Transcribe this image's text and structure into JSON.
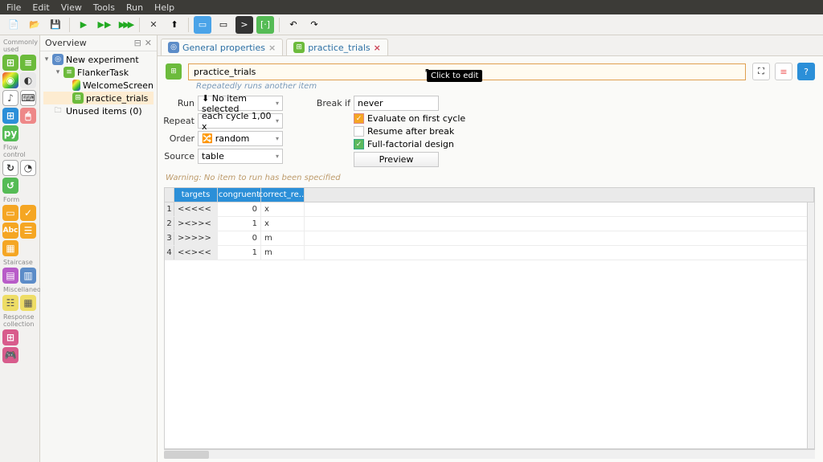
{
  "menu": [
    "File",
    "Edit",
    "View",
    "Tools",
    "Run",
    "Help"
  ],
  "overview": {
    "title": "Overview",
    "items": {
      "root": "New experiment",
      "sequence": "FlankerTask",
      "welcome": "WelcomeScreen",
      "loop": "practice_trials",
      "unused": "Unused items (0)"
    }
  },
  "tabs": {
    "general": "General properties",
    "current": "practice_trials"
  },
  "title_input": "practice_trials",
  "subtitle": "Repeatedly runs another item",
  "tooltip": "Click to edit",
  "form": {
    "run_label": "Run",
    "run_value": "⬇ No item selected",
    "repeat_label": "Repeat",
    "repeat_value": "each cycle 1,00 x",
    "order_label": "Order",
    "order_value": "random",
    "source_label": "Source",
    "source_value": "table",
    "breakif_label": "Break if",
    "breakif_value": "never",
    "eval_first": "Evaluate on first cycle",
    "resume": "Resume after break",
    "fullfact": "Full-factorial design",
    "preview": "Preview"
  },
  "warning": "Warning: No item to run has been specified",
  "chart_data": {
    "type": "table",
    "columns": [
      "targets",
      "congruent",
      "correct_re..."
    ],
    "rows": [
      {
        "targets": "<<<<<",
        "congruent": 0,
        "correct_response": "x"
      },
      {
        "targets": "><>><",
        "congruent": 1,
        "correct_response": "x"
      },
      {
        "targets": ">>>>>",
        "congruent": 0,
        "correct_response": "m"
      },
      {
        "targets": "<<><<",
        "congruent": 1,
        "correct_response": "m"
      }
    ]
  },
  "left_tool_groups": {
    "g1": "Commonly used",
    "g2": "Flow control",
    "g3": "Form",
    "g4": "Staircase",
    "g5": "Miscellaneous",
    "g6": "Response collection"
  }
}
